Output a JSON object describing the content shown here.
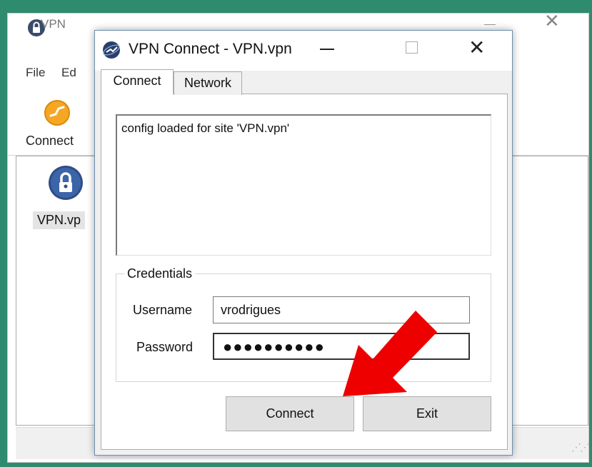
{
  "back_window": {
    "title": "VPN",
    "menu": [
      "File",
      "Ed"
    ],
    "toolbar_label": "Connect",
    "list_item": "VPN.vp",
    "close_glyph": "✕"
  },
  "dialog": {
    "title": "VPN Connect - VPN.vpn",
    "close_glyph": "✕",
    "tabs": [
      {
        "label": "Connect",
        "active": true
      },
      {
        "label": "Network",
        "active": false
      }
    ],
    "log": "config loaded for site 'VPN.vpn'",
    "credentials": {
      "legend": "Credentials",
      "username_label": "Username",
      "username": "vrodrigues",
      "password_label": "Password",
      "password_masked": "●●●●●●●●●●"
    },
    "buttons": {
      "connect": "Connect",
      "exit": "Exit"
    }
  },
  "colors": {
    "background": "#2e8b6e",
    "arrow": "#ee0000",
    "title_border": "#6b8fb5"
  },
  "icons": [
    "lock-app-icon",
    "vpn-globe-icon",
    "connect-icon",
    "lock-profile-icon",
    "red-arrow-icon"
  ]
}
